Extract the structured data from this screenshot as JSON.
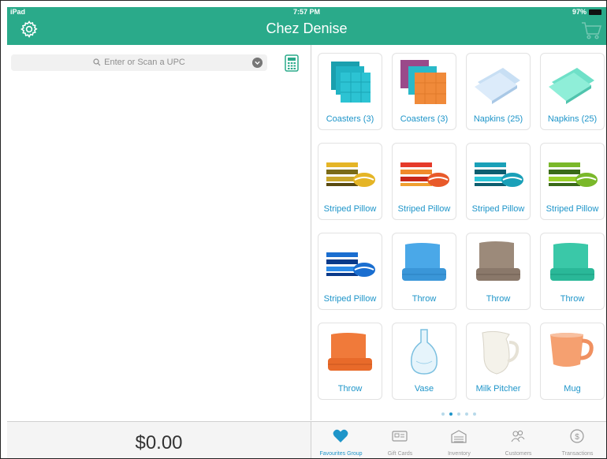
{
  "status_bar": {
    "device": "iPad",
    "time": "7:57 PM",
    "battery": "97%"
  },
  "header": {
    "title": "Chez Denise"
  },
  "search": {
    "placeholder": "Enter or Scan a UPC"
  },
  "cart_total": "$0.00",
  "products": [
    {
      "label": "Coasters (3)",
      "icon": "coasters-teal-icon"
    },
    {
      "label": "Coasters (3)",
      "icon": "coasters-mixed-icon"
    },
    {
      "label": "Napkins (25)",
      "icon": "napkins-blue-icon"
    },
    {
      "label": "Napkins (25)",
      "icon": "napkins-mint-icon"
    },
    {
      "label": "Striped Pillow",
      "icon": "pillow-yellow-icon"
    },
    {
      "label": "Striped Pillow",
      "icon": "pillow-red-icon"
    },
    {
      "label": "Striped Pillow",
      "icon": "pillow-teal-icon"
    },
    {
      "label": "Striped Pillow",
      "icon": "pillow-green-icon"
    },
    {
      "label": "Striped Pillow",
      "icon": "pillow-blue-icon"
    },
    {
      "label": "Throw",
      "icon": "throw-blue-icon"
    },
    {
      "label": "Throw",
      "icon": "throw-taupe-icon"
    },
    {
      "label": "Throw",
      "icon": "throw-teal-icon"
    },
    {
      "label": "Throw",
      "icon": "throw-orange-icon"
    },
    {
      "label": "Vase",
      "icon": "vase-icon"
    },
    {
      "label": "Milk Pitcher",
      "icon": "pitcher-icon"
    },
    {
      "label": "Mug",
      "icon": "mug-icon"
    }
  ],
  "page_indicator": {
    "count": 5,
    "current": 2
  },
  "tabs": [
    {
      "label": "Favourites Group",
      "icon": "heart-icon",
      "active": true
    },
    {
      "label": "Gift Cards",
      "icon": "gift-card-icon",
      "active": false
    },
    {
      "label": "Inventory",
      "icon": "inventory-icon",
      "active": false
    },
    {
      "label": "Customers",
      "icon": "customers-icon",
      "active": false
    },
    {
      "label": "Transactions",
      "icon": "transactions-icon",
      "active": false
    }
  ],
  "colors": {
    "header": "#2aaa8a",
    "accent": "#1e95c9"
  }
}
